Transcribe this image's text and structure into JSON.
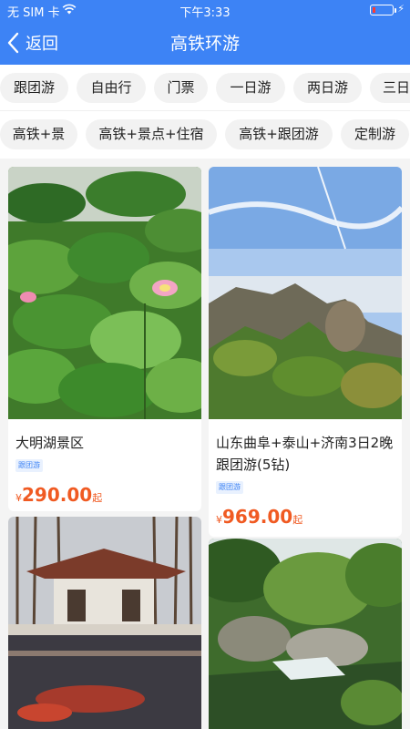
{
  "status_bar": {
    "carrier": "无 SIM 卡",
    "time": "下午3:33",
    "icons": [
      "wifi-icon",
      "battery-icon",
      "charging-icon"
    ]
  },
  "nav": {
    "back_label": "返回",
    "title": "高铁环游"
  },
  "categories_row1": [
    "跟团游",
    "自由行",
    "门票",
    "一日游",
    "两日游",
    "三日"
  ],
  "categories_row2": [
    "高铁+景",
    "高铁+景点+住宿",
    "高铁+跟团游",
    "定制游"
  ],
  "products": [
    {
      "name": "大明湖景区",
      "tag": "跟团游",
      "currency": "¥",
      "price": "290.00",
      "suffix": "起",
      "image": "lotus-pond-photo"
    },
    {
      "name": "山东曲阜+泰山+济南3日2晚跟团游(5钻)",
      "tag": "跟团游",
      "currency": "¥",
      "price": "969.00",
      "suffix": "起",
      "image": "mountain-summit-photo"
    },
    {
      "name": "",
      "image": "lake-pavilion-photo"
    },
    {
      "name": "",
      "image": "valley-waterfall-photo"
    }
  ],
  "colors": {
    "primary": "#3d83f5",
    "price": "#f05a22",
    "chip_bg": "#f2f2f2",
    "page_bg": "#f4f4f4"
  }
}
